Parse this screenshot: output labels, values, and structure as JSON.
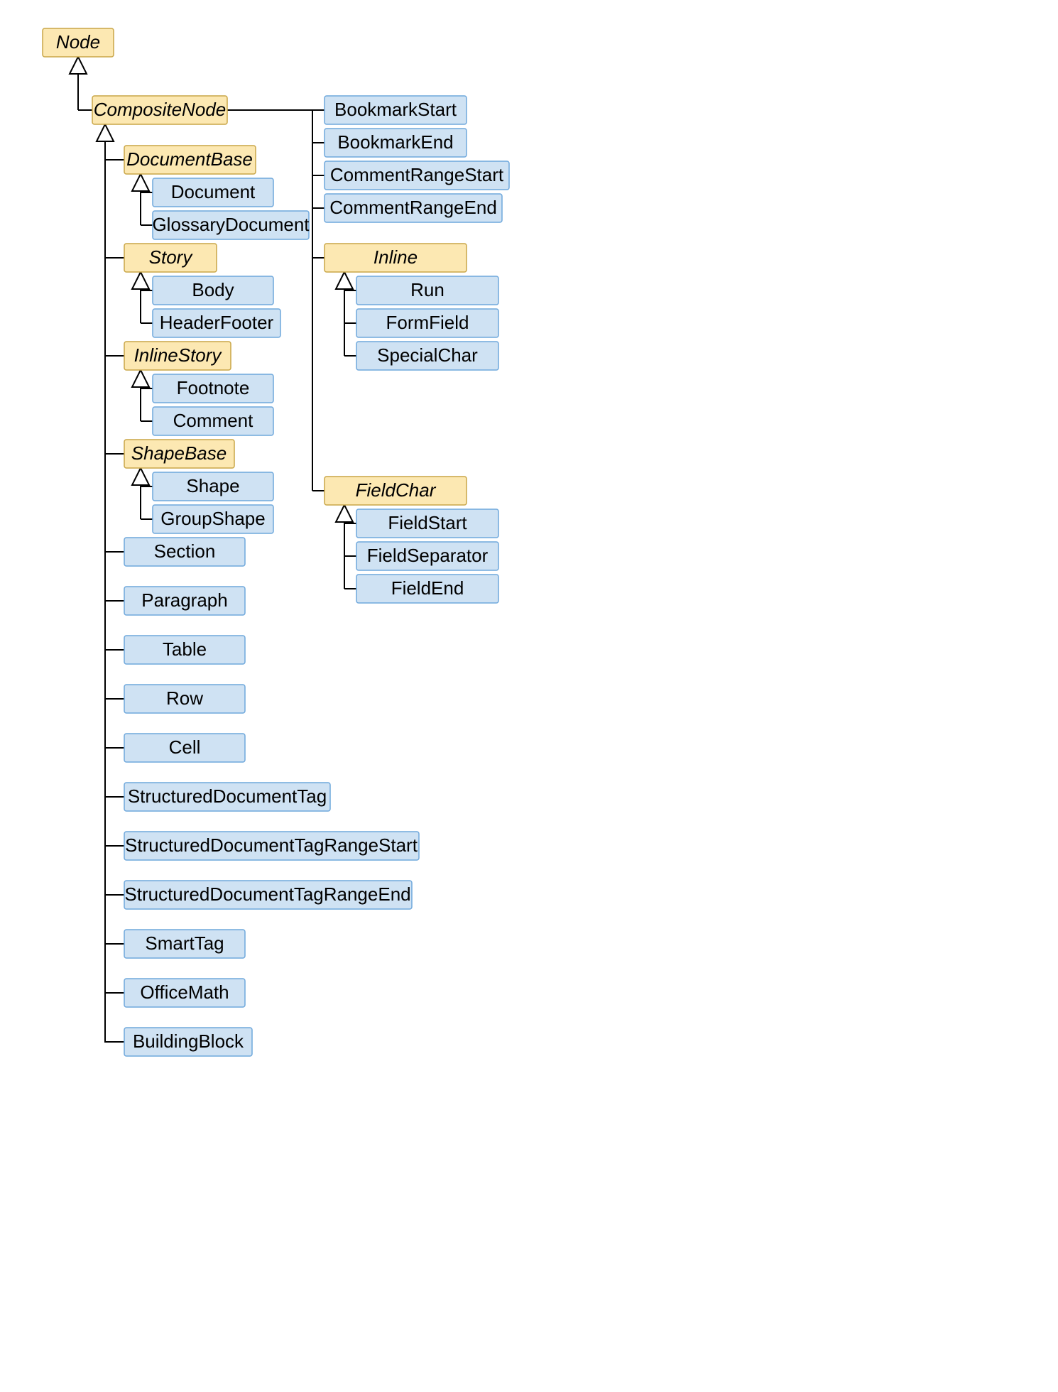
{
  "nodes": {
    "Node": "Node",
    "CompositeNode": "CompositeNode",
    "DocumentBase": "DocumentBase",
    "Document": "Document",
    "GlossaryDocument": "GlossaryDocument",
    "Story": "Story",
    "Body": "Body",
    "HeaderFooter": "HeaderFooter",
    "InlineStory": "InlineStory",
    "Footnote": "Footnote",
    "Comment": "Comment",
    "ShapeBase": "ShapeBase",
    "Shape": "Shape",
    "GroupShape": "GroupShape",
    "Section": "Section",
    "Paragraph": "Paragraph",
    "Table": "Table",
    "Row": "Row",
    "Cell": "Cell",
    "StructuredDocumentTag": "StructuredDocumentTag",
    "StructuredDocumentTagRangeStart": "StructuredDocumentTagRangeStart",
    "StructuredDocumentTagRangeEnd": "StructuredDocumentTagRangeEnd",
    "SmartTag": "SmartTag",
    "OfficeMath": "OfficeMath",
    "BuildingBlock": "BuildingBlock",
    "BookmarkStart": "BookmarkStart",
    "BookmarkEnd": "BookmarkEnd",
    "CommentRangeStart": "CommentRangeStart",
    "CommentRangeEnd": "CommentRangeEnd",
    "Inline": "Inline",
    "Run": "Run",
    "FormField": "FormField",
    "SpecialChar": "SpecialChar",
    "FieldChar": "FieldChar",
    "FieldStart": "FieldStart",
    "FieldSeparator": "FieldSeparator",
    "FieldEnd": "FieldEnd"
  }
}
